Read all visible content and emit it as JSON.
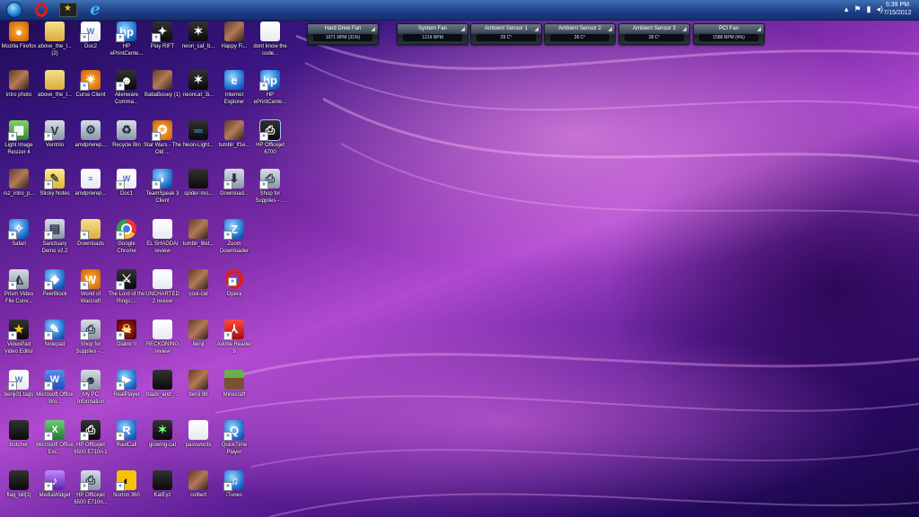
{
  "taskbar": {
    "clock_time": "5:39 PM",
    "clock_date": "7/15/2012",
    "tray_icons": [
      "chevron-up-icon",
      "flag-icon",
      "network-icon",
      "volume-icon"
    ],
    "pinned": [
      "windows-start-orb",
      "opera-icon",
      "videopad-icon",
      "internet-explorer-icon"
    ]
  },
  "gadgets": [
    {
      "title": "Hard Drive Fan",
      "value": "1071 RPM  (31%)"
    },
    {
      "title": "System Fan",
      "value": "1214 RPM"
    },
    {
      "title": "Ambient Sensor 1",
      "value": "29 C°"
    },
    {
      "title": "Ambient Sensor 2",
      "value": "28 C°"
    },
    {
      "title": "Ambient Sensor 3",
      "value": "28 C°"
    },
    {
      "title": "PCI Fan",
      "value": "1588 RPM  (4%)"
    }
  ],
  "desktop_icons": [
    {
      "label": "Mozilla Firefox",
      "icon": "firefox-icon"
    },
    {
      "label": "above_the_l... (2)",
      "icon": "folder-icon"
    },
    {
      "label": "Doc2",
      "icon": "document-icon"
    },
    {
      "label": "HP ePrintCente...",
      "icon": "hp-eprint-icon"
    },
    {
      "label": "Play RIFT",
      "icon": "rift-icon"
    },
    {
      "label": "neon_cat_b...",
      "icon": "image-icon"
    },
    {
      "label": "Happy Fi...",
      "icon": "image-icon"
    },
    {
      "label": "dont know the code...",
      "icon": "document-icon"
    },
    {
      "label": "intro photo",
      "icon": "image-icon"
    },
    {
      "label": "above_the_l...",
      "icon": "folder-icon"
    },
    {
      "label": "Curse Client",
      "icon": "curse-icon"
    },
    {
      "label": "Alienware Comma...",
      "icon": "alienware-icon"
    },
    {
      "label": "BabaBooey (1)",
      "icon": "image-icon"
    },
    {
      "label": "neoncat_3i...",
      "icon": "image-icon"
    },
    {
      "label": "Internet Explorer",
      "icon": "internet-explorer-icon"
    },
    {
      "label": "HP ePrintCente...",
      "icon": "hp-eprint-icon"
    },
    {
      "label": "Light Image Resizer 4",
      "icon": "image-resizer-icon"
    },
    {
      "label": "Ventrilo",
      "icon": "ventrilo-icon"
    },
    {
      "label": "amdprwrep...",
      "icon": "document-icon"
    },
    {
      "label": "Recycle Bin",
      "icon": "recycle-bin-icon"
    },
    {
      "label": "Star Wars - The Old ...",
      "icon": "star-wars-icon"
    },
    {
      "label": "Neon-Light...",
      "icon": "image-icon"
    },
    {
      "label": "tumblr_lf1e...",
      "icon": "image-icon"
    },
    {
      "label": "HP Officejet 6700",
      "icon": "printer-icon"
    },
    {
      "label": "rsz_intro_p...",
      "icon": "image-icon"
    },
    {
      "label": "Sticky Notes",
      "icon": "sticky-notes-icon"
    },
    {
      "label": "amdprwrep...",
      "icon": "document-icon"
    },
    {
      "label": "Doc1",
      "icon": "document-icon"
    },
    {
      "label": "TeamSpeak 3 Client",
      "icon": "teamspeak-icon"
    },
    {
      "label": "spider-mo...",
      "icon": "image-icon"
    },
    {
      "label": "Download...",
      "icon": "download-icon"
    },
    {
      "label": "Shop for Supplies - ...",
      "icon": "printer-icon"
    },
    {
      "label": "Safari",
      "icon": "safari-icon"
    },
    {
      "label": "Sanctuary Demo v2.2",
      "icon": "game-icon"
    },
    {
      "label": "Downloads",
      "icon": "folder-icon"
    },
    {
      "label": "Google Chrome",
      "icon": "chrome-icon"
    },
    {
      "label": "EL SHADDAI review",
      "icon": "document-icon"
    },
    {
      "label": "tumblr_l8et...",
      "icon": "image-icon"
    },
    {
      "label": "Zoom Downloader",
      "icon": "zoom-downloader-icon"
    },
    {
      "label": "Prism Video File Conv...",
      "icon": "prism-icon"
    },
    {
      "label": "PeerBlock",
      "icon": "peerblock-icon"
    },
    {
      "label": "World of Warcraft",
      "icon": "warcraft-icon"
    },
    {
      "label": "The Lord of the Rings:...",
      "icon": "game-icon"
    },
    {
      "label": "UNCHARTED 2 review",
      "icon": "document-icon"
    },
    {
      "label": "cool-cat",
      "icon": "image-icon"
    },
    {
      "label": "Opera",
      "icon": "opera-icon"
    },
    {
      "label": "VideoPad Video Editor",
      "icon": "videopad-icon"
    },
    {
      "label": "Notepad",
      "icon": "notepad-icon"
    },
    {
      "label": "Shop for Supplies - ...",
      "icon": "printer-icon"
    },
    {
      "label": "Diablo II",
      "icon": "diablo-icon"
    },
    {
      "label": "RECKONING review",
      "icon": "document-icon"
    },
    {
      "label": "benji",
      "icon": "image-icon"
    },
    {
      "label": "Adobe Reader 9",
      "icon": "adobe-reader-icon"
    },
    {
      "label": "benji01 tags",
      "icon": "document-icon"
    },
    {
      "label": "Microsoft Office Wo...",
      "icon": "word-icon"
    },
    {
      "label": "My PC Information",
      "icon": "alienware-icon"
    },
    {
      "label": "RealPlayer",
      "icon": "realplayer-icon"
    },
    {
      "label": "black_and_...",
      "icon": "image-icon"
    },
    {
      "label": "benji 98",
      "icon": "image-icon"
    },
    {
      "label": "Minecraft",
      "icon": "minecraft-icon"
    },
    {
      "label": "butcher",
      "icon": "image-icon"
    },
    {
      "label": "Microsoft Office Exc...",
      "icon": "excel-icon"
    },
    {
      "label": "HP Officejet 6500 E710n-z",
      "icon": "printer-icon"
    },
    {
      "label": "RaidCall",
      "icon": "raidcall-icon"
    },
    {
      "label": "glowing-cat",
      "icon": "image-icon"
    },
    {
      "label": "passwords",
      "icon": "document-icon"
    },
    {
      "label": "QuickTime Player",
      "icon": "quicktime-icon"
    },
    {
      "label": "flag_bill[1]",
      "icon": "image-icon"
    },
    {
      "label": "MediaWidget",
      "icon": "media-widget-icon"
    },
    {
      "label": "HP Officejet 6500 E710n...",
      "icon": "printer-icon"
    },
    {
      "label": "Norton 360",
      "icon": "norton-icon"
    },
    {
      "label": "KatEyz",
      "icon": "image-icon"
    },
    {
      "label": "colbert",
      "icon": "image-icon"
    },
    {
      "label": "iTunes",
      "icon": "itunes-icon"
    }
  ]
}
